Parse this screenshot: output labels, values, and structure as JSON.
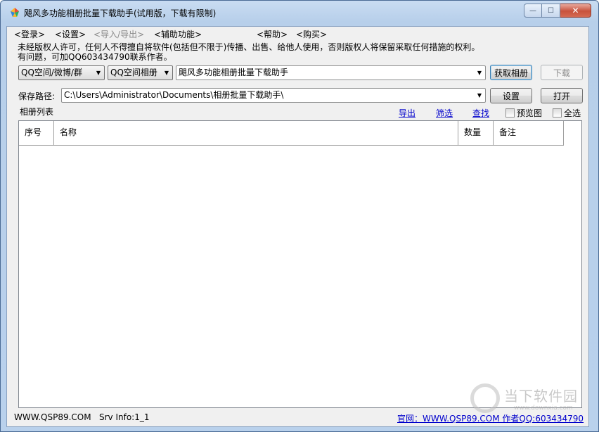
{
  "window": {
    "title": "飓风多功能相册批量下载助手(试用版，下载有限制)",
    "min_icon": "minimize-icon",
    "max_icon": "maximize-icon",
    "close_icon": "close-icon",
    "min_glyph": "—",
    "max_glyph": "☐",
    "close_glyph": "✕"
  },
  "menu": {
    "items": [
      {
        "label": "<登录>"
      },
      {
        "label": "<设置>"
      },
      {
        "label": "<导入/导出>"
      },
      {
        "label": "<辅助功能>"
      },
      {
        "label": "<帮助>"
      },
      {
        "label": "<购买>"
      }
    ]
  },
  "notice": {
    "line1": "未经版权人许可，任何人不得擅自将软件(包括但不限于)传播、出售、给他人使用，否则版权人将保留采取任何措施的权利。",
    "line2": "有问题，可加QQ603434790联系作者。"
  },
  "toolbar": {
    "source_select": "QQ空间/微博/群",
    "type_select": "QQ空间相册",
    "target_input": "飓风多功能相册批量下载助手",
    "get_album_button": "获取相册",
    "download_button": "下载",
    "arrow_glyph": "▼"
  },
  "path": {
    "label": "保存路径:",
    "value": "C:\\Users\\Administrator\\Documents\\相册批量下载助手\\",
    "settings_button": "设置",
    "open_button": "打开"
  },
  "album_list": {
    "label": "相册列表",
    "export_link": "导出",
    "filter_link": "筛选",
    "search_link": "查找",
    "preview_checkbox": "预览图",
    "select_all_checkbox": "全选",
    "columns": [
      "序号",
      "名称",
      "数量",
      "备注"
    ]
  },
  "status": {
    "site": "WWW.QSP89.COM",
    "srv_info": "Srv Info:1_1",
    "official_site": "官网：WWW.QSP89.COM 作者QQ:603434790"
  },
  "watermark": {
    "name": "当下软件园",
    "url": "www.downxia.com"
  },
  "colors": {
    "accent": "#0000cc",
    "frame": "#b9d1ec"
  }
}
